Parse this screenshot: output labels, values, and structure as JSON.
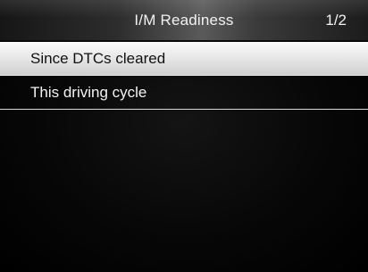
{
  "header": {
    "title": "I/M Readiness",
    "page_indicator": "1/2"
  },
  "menu": {
    "items": [
      {
        "label": "Since DTCs cleared",
        "selected": true
      },
      {
        "label": "This driving cycle",
        "selected": false
      }
    ]
  },
  "colors": {
    "background": "#000000",
    "highlight": "#e9e9e9",
    "text_light": "#f2f2f2",
    "text_dark": "#111111",
    "divider": "#d9d9d9"
  }
}
